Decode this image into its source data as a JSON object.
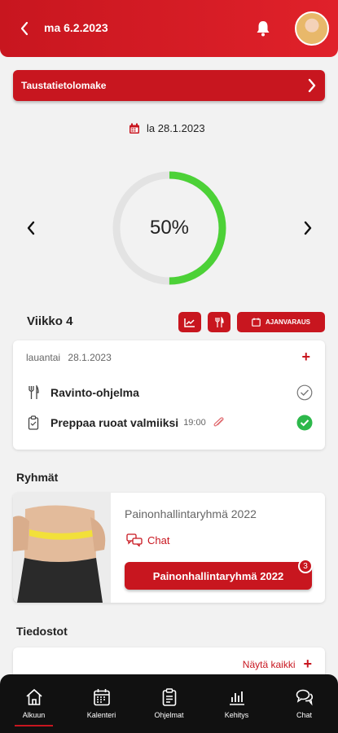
{
  "header": {
    "date": "ma 6.2.2023"
  },
  "banner": {
    "label": "Taustatietolomake"
  },
  "selected_date": "la 28.1.2023",
  "progress": {
    "value": 0.5,
    "label": "50%"
  },
  "week": {
    "title": "Viikko 4",
    "booking_label": "AJANVARAUS"
  },
  "day_card": {
    "weekday": "lauantai",
    "date": "28.1.2023",
    "tasks": [
      {
        "label": "Ravinto-ohjelma",
        "time": "",
        "done": false
      },
      {
        "label": "Preppaa ruoat valmiiksi",
        "time": "19:00",
        "done": true
      }
    ]
  },
  "groups": {
    "title": "Ryhmät",
    "name": "Painonhallintaryhmä 2022",
    "chat_label": "Chat",
    "button_label": "Painonhallintaryhmä 2022",
    "badge": "3"
  },
  "files": {
    "title": "Tiedostot",
    "show_all": "Näytä kaikki"
  },
  "nav": {
    "items": [
      {
        "label": "Alkuun",
        "icon": "home-icon",
        "active": true
      },
      {
        "label": "Kalenteri",
        "icon": "calendar-icon",
        "active": false
      },
      {
        "label": "Ohjelmat",
        "icon": "clipboard-icon",
        "active": false
      },
      {
        "label": "Kehitys",
        "icon": "bar-chart-icon",
        "active": false
      },
      {
        "label": "Chat",
        "icon": "chat-icon",
        "active": false
      }
    ]
  },
  "colors": {
    "brand": "#c8161f",
    "progress": "#4cd137",
    "track": "#e3e3e3"
  }
}
